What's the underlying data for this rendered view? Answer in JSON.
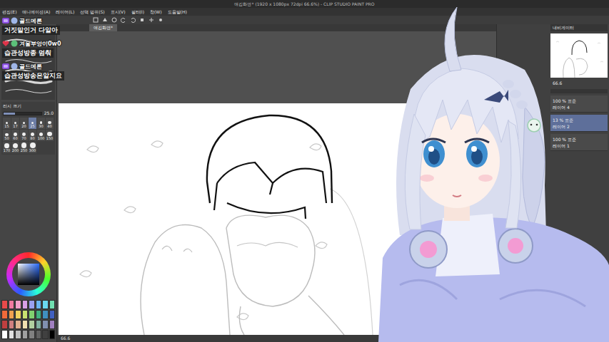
{
  "window": {
    "title": "애김화면* (1920 x 1080px 72dpi 66.6%) - CLIP STUDIO PAINT PRO"
  },
  "menu": [
    "편집(E)",
    "애니메이션(A)",
    "레이어(L)",
    "선택 범위(S)",
    "표시(V)",
    "필터(I)",
    "창(W)",
    "도움말(H)"
  ],
  "document_tab": {
    "label": "애김화면*",
    "selected": true
  },
  "chat": [
    {
      "user": "골드메론",
      "message": "거짓말인거 다알아",
      "kind": "subscriber"
    },
    {
      "user": "겨울부엉이0w0",
      "message": "습관성방종 멈춰",
      "kind": "heart"
    },
    {
      "user": "골드메론",
      "message": "습관성방송은알지요",
      "kind": "subscriber"
    }
  ],
  "brush_size": {
    "title": "러시 크기",
    "value": "25.0",
    "level": 0.3,
    "presets": [
      {
        "size": "15",
        "selected": false
      },
      {
        "size": "17",
        "selected": false
      },
      {
        "size": "20",
        "selected": false
      },
      {
        "size": "25",
        "selected": true
      },
      {
        "size": "30",
        "selected": false
      },
      {
        "size": "40",
        "selected": false
      },
      {
        "size": "50",
        "selected": false
      },
      {
        "size": "60",
        "selected": false
      },
      {
        "size": "70",
        "selected": false
      },
      {
        "size": "80",
        "selected": false
      },
      {
        "size": "100",
        "selected": false
      },
      {
        "size": "150",
        "selected": false
      },
      {
        "size": "170",
        "selected": false
      },
      {
        "size": "200",
        "selected": false
      },
      {
        "size": "250",
        "selected": false
      },
      {
        "size": "300",
        "selected": false
      }
    ]
  },
  "palette": [
    {
      "color": "#e84a4a"
    },
    {
      "color": "#f07aa0"
    },
    {
      "color": "#f0a0c8"
    },
    {
      "color": "#d9a0e6"
    },
    {
      "color": "#9aa0f0"
    },
    {
      "color": "#6ab4f0"
    },
    {
      "color": "#6ad8f0"
    },
    {
      "color": "#70e0b0"
    },
    {
      "color": "#f06a3a"
    },
    {
      "color": "#f0a050"
    },
    {
      "color": "#f0d060"
    },
    {
      "color": "#c8e070"
    },
    {
      "color": "#80d070"
    },
    {
      "color": "#40b080"
    },
    {
      "color": "#4090c0"
    },
    {
      "color": "#4060c0"
    },
    {
      "color": "#c04040"
    },
    {
      "color": "#d08080"
    },
    {
      "color": "#e0b090"
    },
    {
      "color": "#f0e0b0"
    },
    {
      "color": "#b0d0a0"
    },
    {
      "color": "#80b0a0"
    },
    {
      "color": "#8090b0"
    },
    {
      "color": "#a080c0"
    },
    {
      "color": "#ffffff"
    },
    {
      "color": "#e0e0e0"
    },
    {
      "color": "#c0c0c0"
    },
    {
      "color": "#a0a0a0"
    },
    {
      "color": "#808080"
    },
    {
      "color": "#606060"
    },
    {
      "color": "#404040"
    },
    {
      "color": "#000000"
    }
  ],
  "navigator": {
    "title": "내비게이터",
    "zoom": "66.6"
  },
  "layers": [
    {
      "opacity": "100 %",
      "mode": "표준",
      "name": "레이어 4",
      "selected": false
    },
    {
      "opacity": "13 %",
      "mode": "표준",
      "name": "레이어 2",
      "selected": true
    },
    {
      "opacity": "100 %",
      "mode": "표준",
      "name": "레이어 1",
      "selected": false
    }
  ],
  "status_bar": {
    "zoom": "66.6"
  }
}
